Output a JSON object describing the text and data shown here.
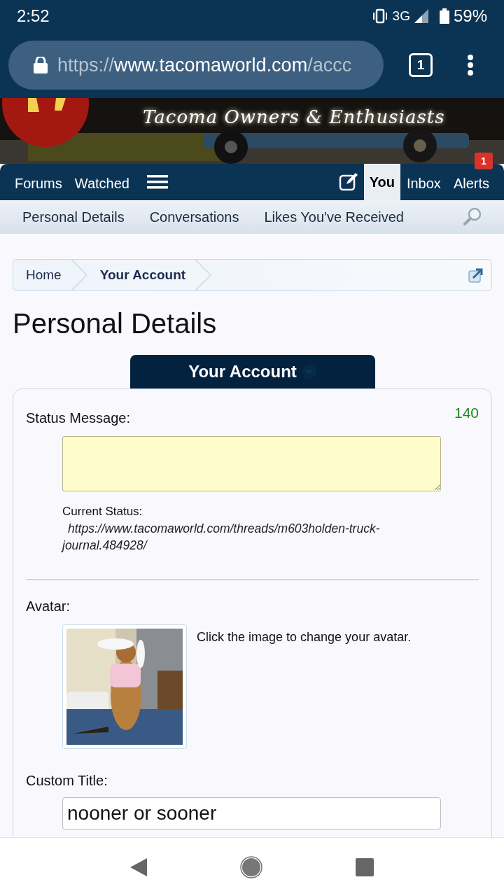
{
  "status_bar": {
    "time": "2:52",
    "network": "3G",
    "battery": "59%"
  },
  "browser": {
    "url_scheme": "https://",
    "url_host": "www.tacomaworld.com",
    "url_path": "/accc",
    "tab_count": "1"
  },
  "banner": {
    "tagline": "Tacoma Owners & Enthusiasts"
  },
  "nav": {
    "left_items": [
      {
        "label": "Forums",
        "selected": false
      },
      {
        "label": "Watched",
        "selected": false
      }
    ],
    "right_items": [
      {
        "label": "You",
        "selected": true
      },
      {
        "label": "Inbox",
        "selected": false
      },
      {
        "label": "Alerts",
        "selected": false,
        "badge": "1"
      }
    ]
  },
  "subnav": {
    "items": [
      "Personal Details",
      "Conversations",
      "Likes You've Received"
    ]
  },
  "breadcrumb": [
    {
      "label": "Home",
      "current": false
    },
    {
      "label": "Your Account",
      "current": true
    }
  ],
  "page_title": "Personal Details",
  "section_tab": "Your Account",
  "form": {
    "status": {
      "label": "Status Message:",
      "counter": "140",
      "current_label": "Current Status:",
      "current_value": "https://www.tacomaworld.com/threads/m603holden-truck-journal.484928/"
    },
    "avatar": {
      "label": "Avatar:",
      "hint": "Click the image to change your avatar."
    },
    "custom_title": {
      "label": "Custom Title:",
      "value": "nooner or sooner"
    }
  }
}
